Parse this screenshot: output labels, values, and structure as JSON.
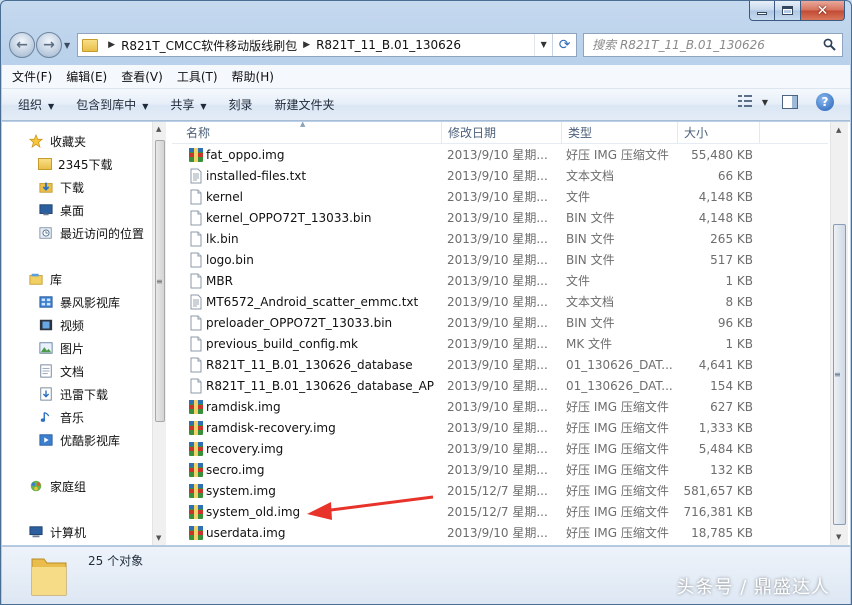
{
  "window": {
    "caption_buttons": [
      "minimize",
      "maximize",
      "close"
    ]
  },
  "address_bar": {
    "crumbs": [
      "R821T_CMCC软件移动版线刷包",
      "R821T_11_B.01_130626"
    ]
  },
  "search": {
    "placeholder": "搜索 R821T_11_B.01_130626"
  },
  "menubar": {
    "items": [
      "文件(F)",
      "编辑(E)",
      "查看(V)",
      "工具(T)",
      "帮助(H)"
    ]
  },
  "commandbar": {
    "organize": "组织",
    "include_in_library": "包含到库中",
    "share": "共享",
    "burn": "刻录",
    "new_folder": "新建文件夹"
  },
  "navpane": {
    "favorites_label": "收藏夹",
    "favorites": [
      "2345下载",
      "下载",
      "桌面",
      "最近访问的位置"
    ],
    "libraries_label": "库",
    "libraries": [
      "暴风影视库",
      "视频",
      "图片",
      "文档",
      "迅雷下载",
      "音乐",
      "优酷影视库"
    ],
    "homegroup": "家庭组",
    "computer": "计算机"
  },
  "columns": {
    "name": "名称",
    "date": "修改日期",
    "type": "类型",
    "size": "大小"
  },
  "files": [
    {
      "name": "fat_oppo.img",
      "date": "2013/9/10 星期...",
      "type": "好压 IMG 压缩文件",
      "size": "55,480 KB",
      "icon": "archive-icon"
    },
    {
      "name": "installed-files.txt",
      "date": "2013/9/10 星期...",
      "type": "文本文档",
      "size": "66 KB",
      "icon": "text-file-icon"
    },
    {
      "name": "kernel",
      "date": "2013/9/10 星期...",
      "type": "文件",
      "size": "4,148 KB",
      "icon": "file-icon"
    },
    {
      "name": "kernel_OPPO72T_13033.bin",
      "date": "2013/9/10 星期...",
      "type": "BIN 文件",
      "size": "4,148 KB",
      "icon": "file-icon"
    },
    {
      "name": "lk.bin",
      "date": "2013/9/10 星期...",
      "type": "BIN 文件",
      "size": "265 KB",
      "icon": "file-icon"
    },
    {
      "name": "logo.bin",
      "date": "2013/9/10 星期...",
      "type": "BIN 文件",
      "size": "517 KB",
      "icon": "file-icon"
    },
    {
      "name": "MBR",
      "date": "2013/9/10 星期...",
      "type": "文件",
      "size": "1 KB",
      "icon": "file-icon"
    },
    {
      "name": "MT6572_Android_scatter_emmc.txt",
      "date": "2013/9/10 星期...",
      "type": "文本文档",
      "size": "8 KB",
      "icon": "text-file-icon"
    },
    {
      "name": "preloader_OPPO72T_13033.bin",
      "date": "2013/9/10 星期...",
      "type": "BIN 文件",
      "size": "96 KB",
      "icon": "file-icon"
    },
    {
      "name": "previous_build_config.mk",
      "date": "2013/9/10 星期...",
      "type": "MK 文件",
      "size": "1 KB",
      "icon": "file-icon"
    },
    {
      "name": "R821T_11_B.01_130626_database",
      "date": "2013/9/10 星期...",
      "type": "01_130626_DAT...",
      "size": "4,641 KB",
      "icon": "file-icon"
    },
    {
      "name": "R821T_11_B.01_130626_database_AP",
      "date": "2013/9/10 星期...",
      "type": "01_130626_DAT...",
      "size": "154 KB",
      "icon": "file-icon"
    },
    {
      "name": "ramdisk.img",
      "date": "2013/9/10 星期...",
      "type": "好压 IMG 压缩文件",
      "size": "627 KB",
      "icon": "archive-icon"
    },
    {
      "name": "ramdisk-recovery.img",
      "date": "2013/9/10 星期...",
      "type": "好压 IMG 压缩文件",
      "size": "1,333 KB",
      "icon": "archive-icon"
    },
    {
      "name": "recovery.img",
      "date": "2013/9/10 星期...",
      "type": "好压 IMG 压缩文件",
      "size": "5,484 KB",
      "icon": "archive-icon"
    },
    {
      "name": "secro.img",
      "date": "2013/9/10 星期...",
      "type": "好压 IMG 压缩文件",
      "size": "132 KB",
      "icon": "archive-icon"
    },
    {
      "name": "system.img",
      "date": "2015/12/7 星期...",
      "type": "好压 IMG 压缩文件",
      "size": "581,657 KB",
      "icon": "archive-icon"
    },
    {
      "name": "system_old.img",
      "date": "2015/12/7 星期...",
      "type": "好压 IMG 压缩文件",
      "size": "716,381 KB",
      "icon": "archive-icon"
    },
    {
      "name": "userdata.img",
      "date": "2013/9/10 星期...",
      "type": "好压 IMG 压缩文件",
      "size": "18,785 KB",
      "icon": "archive-icon"
    }
  ],
  "details": {
    "count": "25 个对象"
  },
  "watermark": "头条号 / 鼎盛达人",
  "colors": {
    "annotation_arrow": "#e8332a",
    "accent": "#2361b7"
  }
}
